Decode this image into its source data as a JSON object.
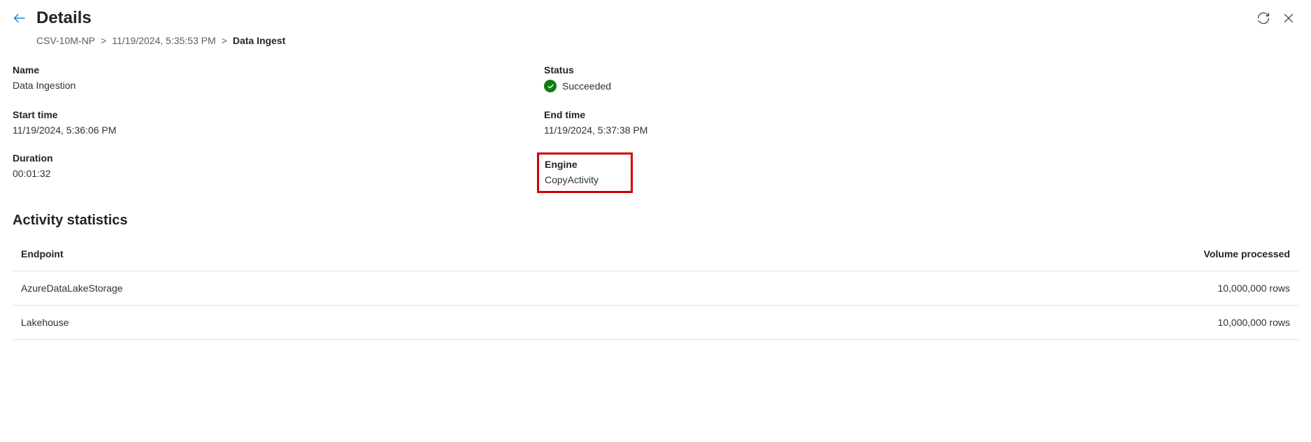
{
  "header": {
    "title": "Details"
  },
  "breadcrumb": {
    "items": [
      {
        "label": "CSV-10M-NP"
      },
      {
        "label": "11/19/2024, 5:35:53 PM"
      }
    ],
    "current": "Data Ingest"
  },
  "details": {
    "name_label": "Name",
    "name_value": "Data Ingestion",
    "status_label": "Status",
    "status_value": "Succeeded",
    "start_time_label": "Start time",
    "start_time_value": "11/19/2024, 5:36:06 PM",
    "end_time_label": "End time",
    "end_time_value": "11/19/2024, 5:37:38 PM",
    "duration_label": "Duration",
    "duration_value": "00:01:32",
    "engine_label": "Engine",
    "engine_value": "CopyActivity"
  },
  "activity": {
    "section_title": "Activity statistics",
    "columns": {
      "endpoint": "Endpoint",
      "volume": "Volume processed"
    },
    "rows": [
      {
        "endpoint": "AzureDataLakeStorage",
        "volume": "10,000,000 rows"
      },
      {
        "endpoint": "Lakehouse",
        "volume": "10,000,000 rows"
      }
    ]
  }
}
